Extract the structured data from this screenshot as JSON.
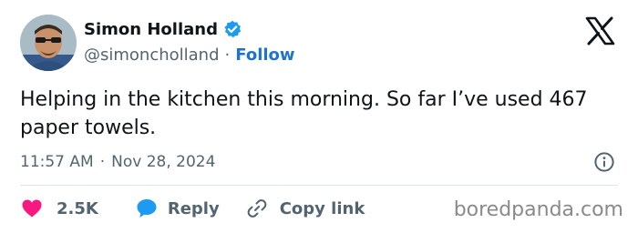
{
  "author": {
    "display_name": "Simon Holland",
    "handle": "@simoncholland",
    "separator": "·",
    "follow_label": "Follow",
    "verified_color": "#1d9bf0"
  },
  "tweet": {
    "text": "Helping in the kitchen this morning. So far I’ve used 467 paper towels.",
    "time": "11:57 AM",
    "separator": "·",
    "date": "Nov 28, 2024"
  },
  "actions": {
    "like_count": "2.5K",
    "reply_label": "Reply",
    "copy_link_label": "Copy link",
    "like_color": "#f91880",
    "reply_color": "#1d9bf0"
  },
  "icons": {
    "brand": "x-logo",
    "info": "info-icon",
    "like": "heart-icon",
    "reply": "speech-bubble-icon",
    "copy": "link-icon"
  },
  "watermark": "boredpanda.com"
}
